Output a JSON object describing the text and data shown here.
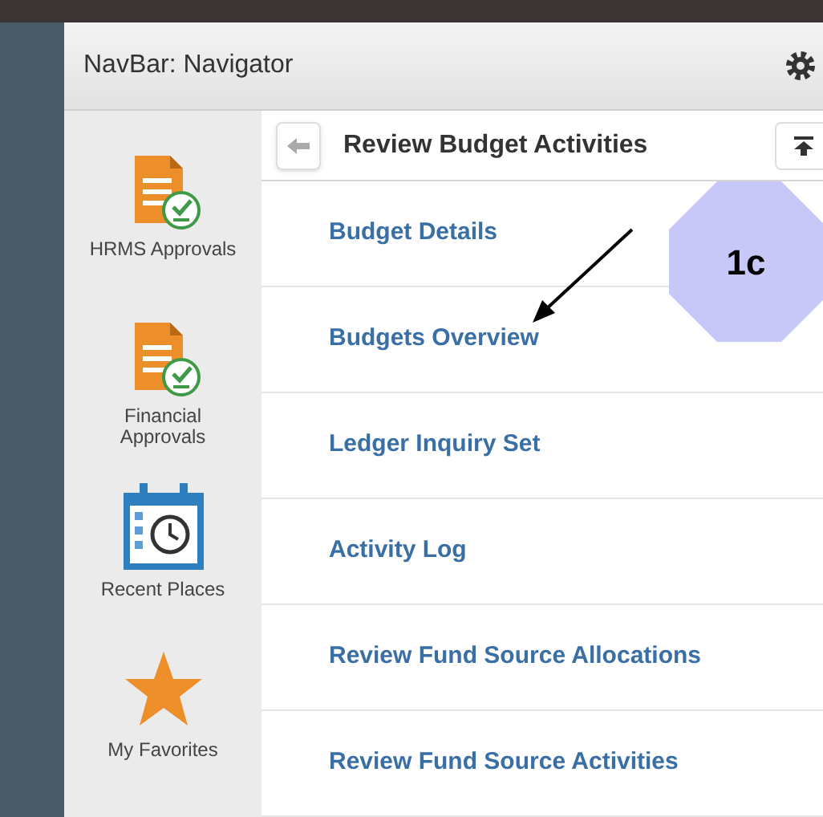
{
  "header": {
    "title": "NavBar: Navigator"
  },
  "sidebar": {
    "items": [
      {
        "label": "HRMS Approvals",
        "kind": "approval"
      },
      {
        "label": "Financial Approvals",
        "kind": "approval"
      },
      {
        "label": "Recent Places",
        "kind": "recent"
      },
      {
        "label": "My Favorites",
        "kind": "favorites"
      }
    ]
  },
  "panel": {
    "title": "Review Budget Activities",
    "items": [
      {
        "label": "Budget Details"
      },
      {
        "label": "Budgets Overview"
      },
      {
        "label": "Ledger Inquiry Set"
      },
      {
        "label": "Activity Log"
      },
      {
        "label": "Review Fund Source Allocations"
      },
      {
        "label": "Review Fund Source Activities"
      }
    ]
  },
  "annotation": {
    "label": "1c"
  }
}
